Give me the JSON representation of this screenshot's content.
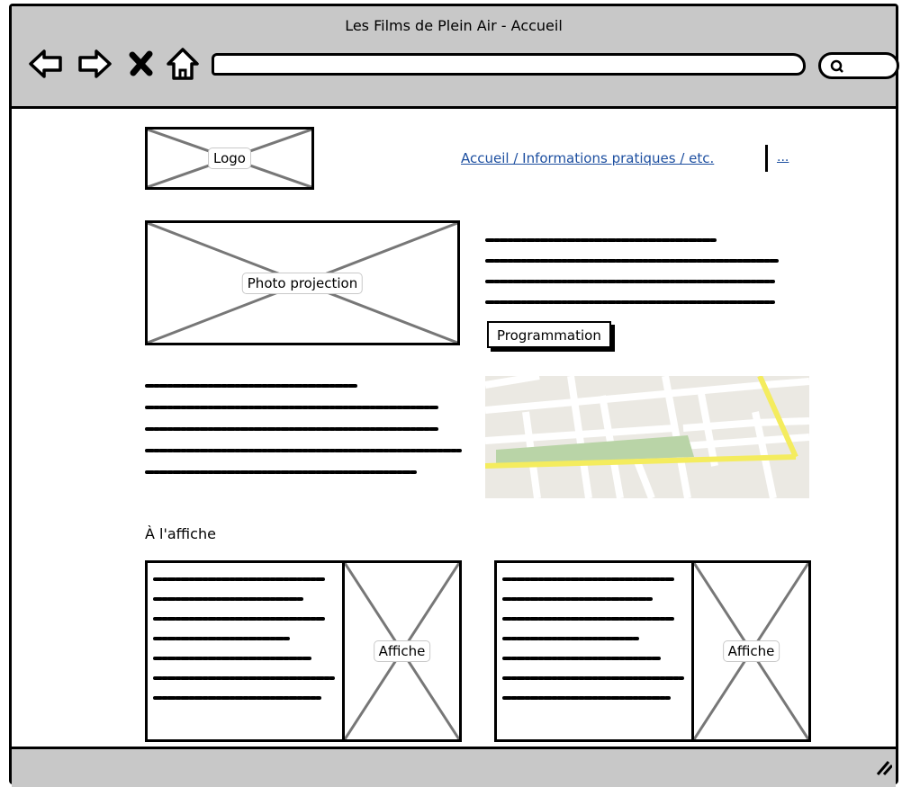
{
  "window": {
    "title": "Les Films de Plein Air - Accueil",
    "url_value": "",
    "search_value": ""
  },
  "header": {
    "logo_label": "Logo",
    "nav_text": "Accueil / Informations pratiques / etc.",
    "nav_more": "..."
  },
  "hero": {
    "photo_label": "Photo projection",
    "programmation_button": "Programmation"
  },
  "now_showing": {
    "title": "À l'affiche",
    "cards": [
      {
        "poster_label": "Affiche"
      },
      {
        "poster_label": "Affiche"
      }
    ]
  },
  "colors": {
    "chrome_gray": "#c8c8c8",
    "link_blue": "#1d4fa0",
    "map_road_yellow": "#f4ec5e",
    "map_park_green": "#b9d4a7",
    "map_background": "#ebe9e3"
  },
  "icons": [
    "back-arrow-icon",
    "forward-arrow-icon",
    "close-x-icon",
    "home-icon",
    "search-icon",
    "resize-grip-icon"
  ]
}
